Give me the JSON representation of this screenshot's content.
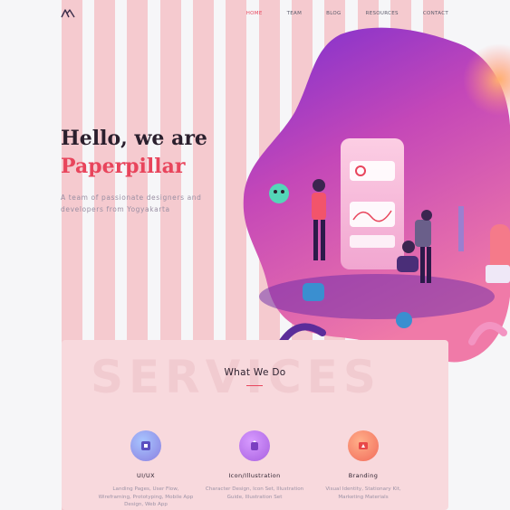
{
  "header": {
    "nav": [
      "HOME",
      "TEAM",
      "BLOG",
      "RESOURCES",
      "CONTACT"
    ],
    "active": "HOME"
  },
  "hero": {
    "title_line1": "Hello, we are",
    "title_line2": "Paperpillar",
    "subtitle": "A team of passionate designers and developers from Yogyakarta"
  },
  "services": {
    "watermark": "SERVICES",
    "title": "What We Do",
    "items": [
      {
        "name": "UI/UX",
        "icon": "design-icon",
        "description": "Landing Pages, User Flow, Wireframing, Prototyping, Mobile App Design, Web App"
      },
      {
        "name": "Icon/Illustration",
        "icon": "illustration-icon",
        "description": "Character Design, Icon Set, Illustration Guide, Illustration Set"
      },
      {
        "name": "Branding",
        "icon": "branding-icon",
        "description": "Visual Identity, Stationary Kit, Marketing Materials"
      }
    ]
  },
  "colors": {
    "accent": "#e8455c",
    "heading": "#2a1f2d",
    "grid_overlay": "#f4c2c8",
    "blob_top": "#8a36c8",
    "blob_bottom": "#f06a9a"
  }
}
